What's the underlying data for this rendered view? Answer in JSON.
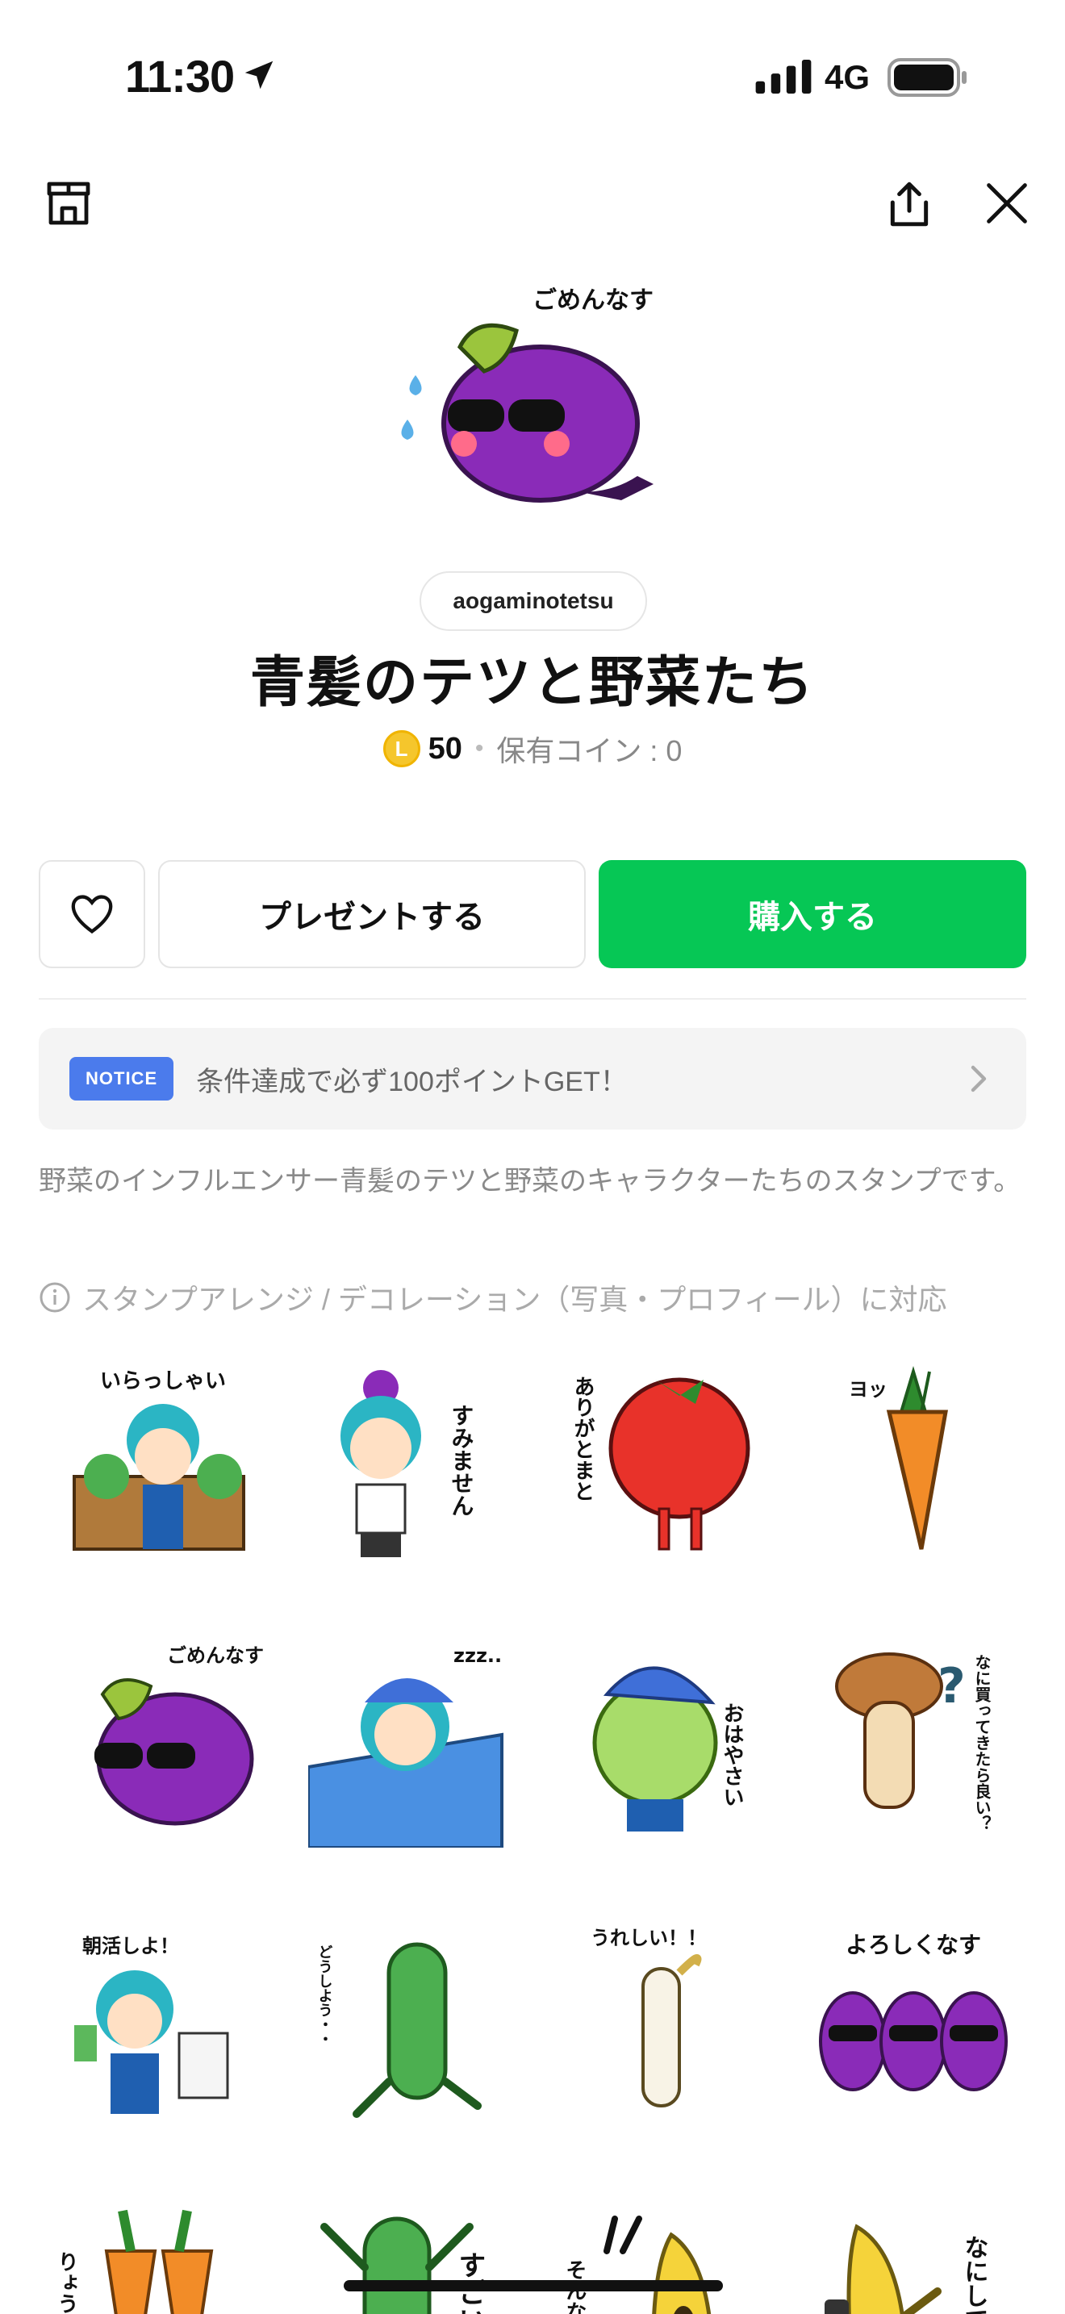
{
  "status_bar": {
    "time": "11:30",
    "network": "4G"
  },
  "product": {
    "author": "aogaminotetsu",
    "title": "青髪のテツと野菜たち",
    "coin_symbol": "L",
    "price": "50",
    "owned_coins": "保有コイン : 0",
    "main_sticker_caption": "ごめんなす"
  },
  "actions": {
    "present_label": "プレゼントする",
    "buy_label": "購入する"
  },
  "notice": {
    "badge": "NOTICE",
    "text": "条件達成で必ず100ポイントGET！"
  },
  "description": "野菜のインフルエンサー青髪のテツと野菜のキャラクターたちのスタンプです。",
  "feature": "スタンプアレンジ / デコレーション（写真・プロフィール）に対応",
  "stickers": [
    {
      "caption": "いらっしゃい",
      "subject": "tetsu-vegetable-stand"
    },
    {
      "caption": "すみません",
      "subject": "tetsu-bowing-with-eggplant"
    },
    {
      "caption": "ありがとまと",
      "subject": "tomato"
    },
    {
      "caption": "ヨッ",
      "subject": "carrot"
    },
    {
      "caption": "ごめんなす",
      "subject": "eggplant-sunglasses"
    },
    {
      "caption": "zzz..",
      "subject": "tetsu-sleeping"
    },
    {
      "caption": "おはやさい",
      "subject": "cabbage"
    },
    {
      "caption": "なに買ってきたら良い？",
      "subject": "mushroom"
    },
    {
      "caption": "朝活しよ！",
      "subject": "tetsu-green-juice"
    },
    {
      "caption": "どうしよう・・",
      "subject": "cucumber-worried"
    },
    {
      "caption": "うれしい！！",
      "subject": "white-radish"
    },
    {
      "caption": "よろしくなす",
      "subject": "three-eggplants"
    },
    {
      "caption": "りょうかい",
      "subject": "two-carrots"
    },
    {
      "caption": "すごい！",
      "subject": "cucumber-excited"
    },
    {
      "caption": "そんなばな",
      "subject": "banana-shocked"
    },
    {
      "caption": "なにしてる",
      "subject": "banana-phone"
    }
  ],
  "colors": {
    "buy_green": "#06c755",
    "notice_blue": "#4b7bec",
    "coin_yellow": "#f5c62c"
  }
}
